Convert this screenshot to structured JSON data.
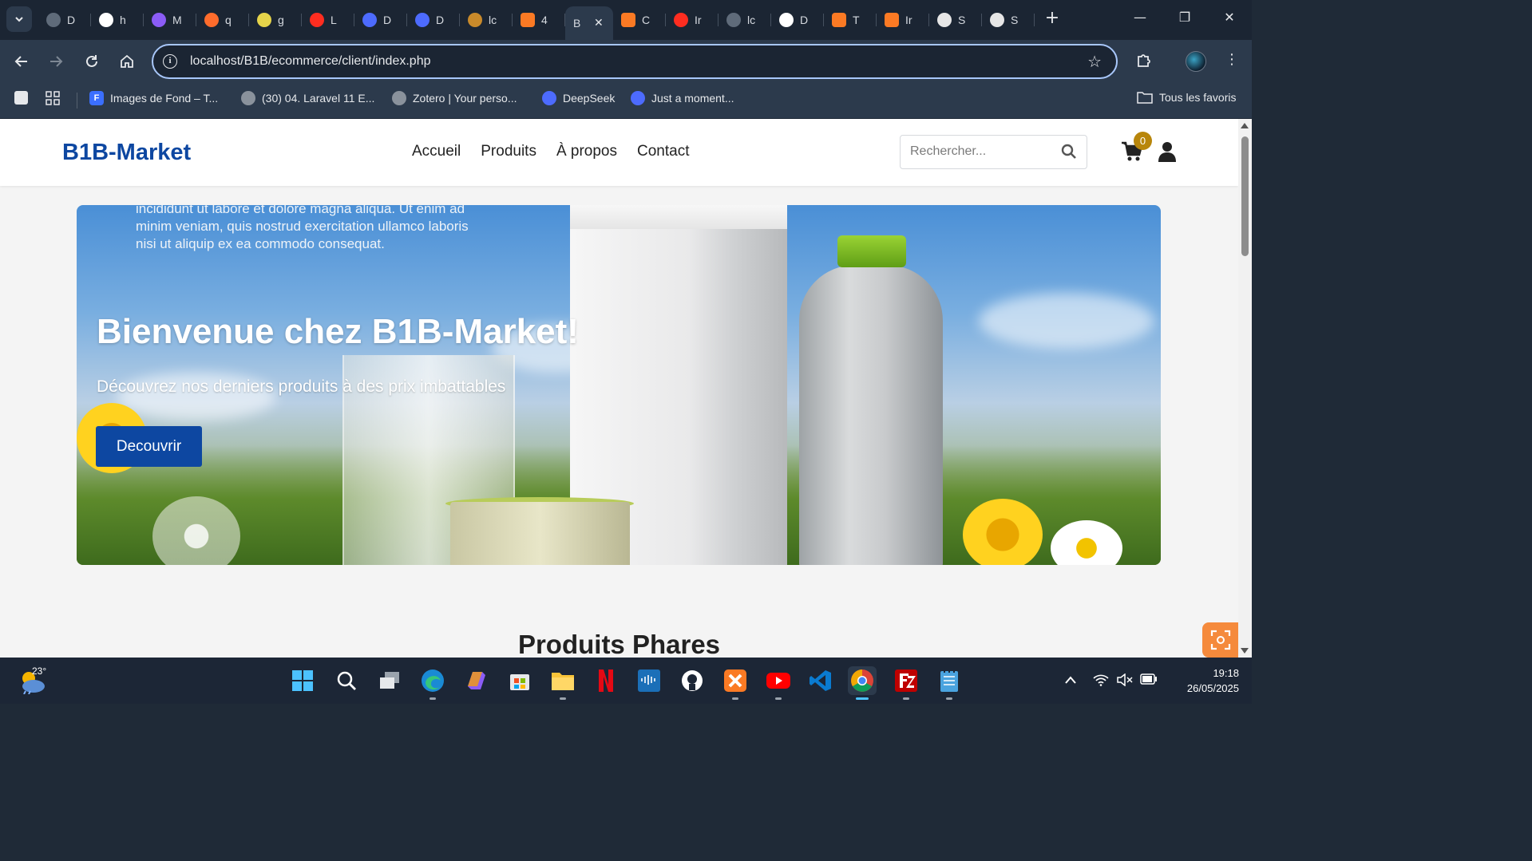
{
  "browser": {
    "tabs": [
      {
        "title": "D",
        "icon": "globe-icon",
        "color": "#5f6b7a"
      },
      {
        "title": "h",
        "icon": "github-icon",
        "color": "#ffffff"
      },
      {
        "title": "M",
        "icon": "meta-icon",
        "color": "#8b5cf6"
      },
      {
        "title": "q",
        "icon": "cpanel-icon",
        "color": "#ff6c2c"
      },
      {
        "title": "g",
        "icon": "clock-icon",
        "color": "#e6d44a"
      },
      {
        "title": "L",
        "icon": "laravel-icon",
        "color": "#ff2d20"
      },
      {
        "title": "D",
        "icon": "deepseek-icon",
        "color": "#4d6bfe"
      },
      {
        "title": "D",
        "icon": "deepseek-icon",
        "color": "#4d6bfe"
      },
      {
        "title": "lc",
        "icon": "mountain-icon",
        "color": "#c98a2a"
      },
      {
        "title": "4",
        "icon": "xampp-icon",
        "color": "#fb7a24"
      },
      {
        "title": "B",
        "icon": "",
        "color": "",
        "active": true
      },
      {
        "title": "C",
        "icon": "xampp-icon",
        "color": "#fb7a24"
      },
      {
        "title": "Ir",
        "icon": "laravel-circle-icon",
        "color": "#ff2d20"
      },
      {
        "title": "lc",
        "icon": "globe-icon",
        "color": "#5f6b7a"
      },
      {
        "title": "D",
        "icon": "slash-icon",
        "color": "#ffffff"
      },
      {
        "title": "T",
        "icon": "xampp-icon",
        "color": "#fb7a24"
      },
      {
        "title": "Ir",
        "icon": "xampp-icon",
        "color": "#fb7a24"
      },
      {
        "title": "S",
        "icon": "white-circle-icon",
        "color": "#e6e6e6"
      },
      {
        "title": "S",
        "icon": "white-circle-icon",
        "color": "#e6e6e6"
      }
    ],
    "url": "localhost/B1B/ecommerce/client/index.php",
    "bookmarks": [
      {
        "label": "Images de Fond – T...",
        "icon": "F",
        "color": "#3b6fff"
      },
      {
        "label": "(30) 04. Laravel 11 E...",
        "icon": "globe",
        "color": "#8a929c"
      },
      {
        "label": "Zotero | Your perso...",
        "icon": "globe",
        "color": "#8a929c"
      },
      {
        "label": "DeepSeek",
        "icon": "whale",
        "color": "#4d6bfe"
      },
      {
        "label": "Just a moment...",
        "icon": "whale",
        "color": "#4d6bfe"
      }
    ],
    "all_bookmarks_label": "Tous les favoris"
  },
  "site": {
    "logo": "B1B-Market",
    "menu": [
      "Accueil",
      "Produits",
      "À propos",
      "Contact"
    ],
    "search_placeholder": "Rechercher...",
    "cart_count": "0",
    "hero": {
      "overflow_text": "incididunt ut labore et dolore magna aliqua. Ut enim ad minim veniam, quis nostrud exercitation ullamco laboris nisi ut aliquip ex ea commodo consequat.",
      "title": "Bienvenue chez B1B-Market!",
      "subtitle": "Découvrez nos derniers produits à des prix imbattables",
      "button": "Decouvrir"
    },
    "section_title": "Produits Phares",
    "brand_color": "#0d47a1"
  },
  "taskbar": {
    "temperature": "23°",
    "time": "19:18",
    "date": "26/05/2025"
  }
}
